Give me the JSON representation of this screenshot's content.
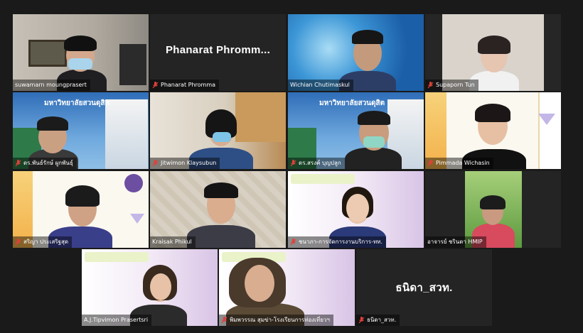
{
  "participants": [
    {
      "name": "suwamarn moungprasert",
      "muted": false,
      "active": true
    },
    {
      "name": "Phanarat Phromma",
      "display_text": "Phanarat  Phromm...",
      "muted": true
    },
    {
      "name": "Wichian Chutimaskul",
      "muted": false
    },
    {
      "name": "Supaporn Tun",
      "muted": true
    },
    {
      "name": "ดร.พันธ์รักษ์ ผูกพันธุ์",
      "muted": true,
      "banner": "มหาวิทยาลัยสวนดุสิต"
    },
    {
      "name": "Jitwimon Klaysubun",
      "muted": true
    },
    {
      "name": "ดร.สรงค์ บุญปลูก",
      "muted": true,
      "banner": "มหาวิทยาลัยสวนดุสิต"
    },
    {
      "name": "Pimmada Wichasin",
      "muted": true
    },
    {
      "name": "สริญา ประเสริฐสุด",
      "muted": true
    },
    {
      "name": "Kraisak Phikul",
      "muted": false
    },
    {
      "name": "ชนาภา-การจัดการงานบริการ-ทท.",
      "muted": true
    },
    {
      "name": "อาจารย์ ชรินดา HMIP",
      "muted": false
    },
    {
      "name": "A.J.Tipvimon Prasertsri",
      "muted": false
    },
    {
      "name": "พิมพวรรณ สุมข่า-โรงเรียนการท่องเที่ยวฯ",
      "muted": true
    },
    {
      "name": "ธนิดา_สวท.",
      "display_text": "ธนิดา_สวท.",
      "muted": true
    }
  ],
  "colors": {
    "active_border": "#b7e36a",
    "muted_icon": "#e0403a",
    "background": "#1a1a1a"
  }
}
